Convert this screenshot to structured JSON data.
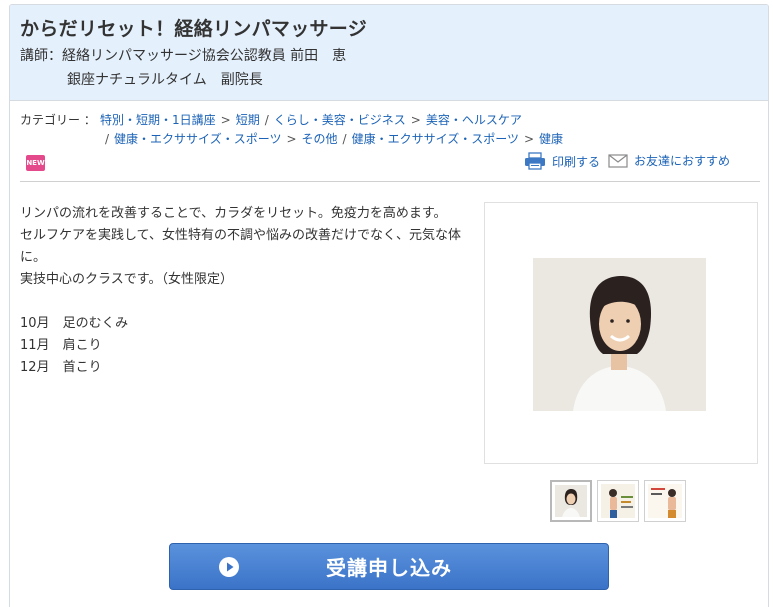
{
  "header": {
    "title": "からだリセット！経絡リンパマッサージ",
    "instructor_line1": "講師：経絡リンパマッサージ協会公認教員 前田　恵",
    "instructor_line2": "銀座ナチュラルタイム　副院長",
    "background_color": "#e4f0fc"
  },
  "categories": {
    "label": "カテゴリー ：",
    "row1": [
      "特別・短期・1日講座",
      "短期",
      "くらし・美容・ビジネス",
      "美容・ヘルスケア"
    ],
    "row2": [
      "健康・エクササイズ・スポーツ",
      "その他",
      "健康・エクササイズ・スポーツ",
      "健康"
    ],
    "link_color": "#1c63b7"
  },
  "badges": {
    "new_label": "NEW",
    "new_color": "#e44a8b"
  },
  "actions": {
    "print_label": "印刷する",
    "print_icon": "printer-icon",
    "share_label": "お友達におすすめ",
    "share_icon": "envelope-icon"
  },
  "description": {
    "line1": "リンパの流れを改善することで、カラダをリセット。免疫力を高めます。",
    "line2": "セルフケアを実践して、女性特有の不調や悩みの改善だけでなく、元気な体に。",
    "line3": "実技中心のクラスです。（女性限定）",
    "schedule": [
      {
        "month": "10月",
        "topic": "足のむくみ"
      },
      {
        "month": "11月",
        "topic": "肩こり"
      },
      {
        "month": "12月",
        "topic": "首こり"
      }
    ]
  },
  "gallery": {
    "thumbnail_count": 3,
    "active_index": 0
  },
  "apply": {
    "label": "受講申し込み",
    "icon": "play-circle-icon",
    "color": "#3b73c8"
  }
}
